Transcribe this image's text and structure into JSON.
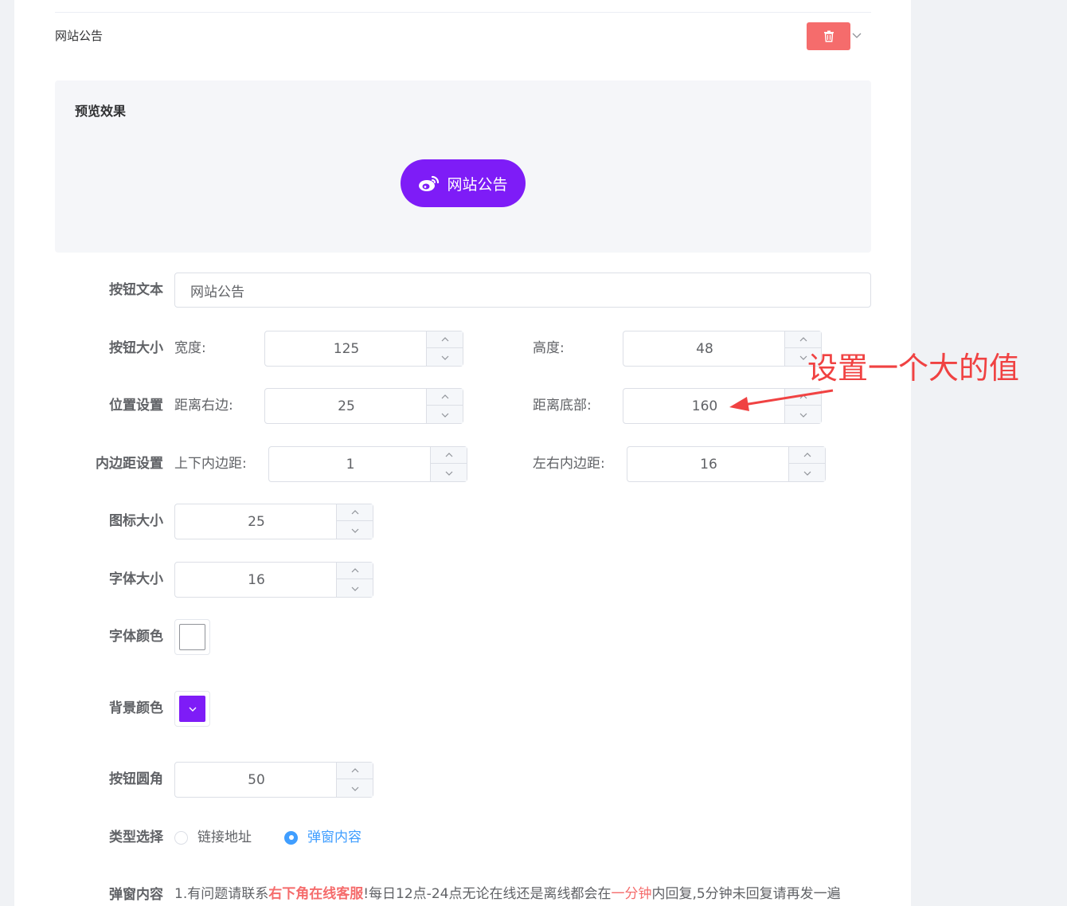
{
  "section": {
    "title": "网站公告"
  },
  "preview": {
    "title": "预览效果",
    "button_text": "网站公告"
  },
  "fields": {
    "button_text": {
      "label": "按钮文本",
      "value": "网站公告"
    },
    "button_size": {
      "label": "按钮大小",
      "width_label": "宽度:",
      "width": "125",
      "height_label": "高度:",
      "height": "48"
    },
    "position": {
      "label": "位置设置",
      "right_label": "距离右边:",
      "right": "25",
      "bottom_label": "距离底部:",
      "bottom": "160"
    },
    "padding": {
      "label": "内边距设置",
      "vertical_label": "上下内边距:",
      "vertical": "1",
      "horizontal_label": "左右内边距:",
      "horizontal": "16"
    },
    "icon_size": {
      "label": "图标大小",
      "value": "25"
    },
    "font_size": {
      "label": "字体大小",
      "value": "16"
    },
    "font_color": {
      "label": "字体颜色",
      "color": "#ffffff"
    },
    "bg_color": {
      "label": "背景颜色",
      "color": "#7e1cf7"
    },
    "radius": {
      "label": "按钮圆角",
      "value": "50"
    },
    "type": {
      "label": "类型选择",
      "option_link": "链接地址",
      "option_popup": "弹窗内容",
      "selected": "弹窗内容"
    },
    "popup": {
      "label": "弹窗内容",
      "part1": "1.有问题请联系",
      "part2": "右下角在线客服",
      "part3": "!每日12点-24点无论在线还是离线都会在",
      "part4": "一分钟",
      "part5": "内回复,5分钟未回复请再发一遍"
    }
  },
  "annotation": {
    "text": "设置一个大的值"
  },
  "colors": {
    "accent": "#409eff",
    "danger": "#f56c6c",
    "annotation": "#f04242",
    "brand_purple": "#7e1cf7"
  }
}
